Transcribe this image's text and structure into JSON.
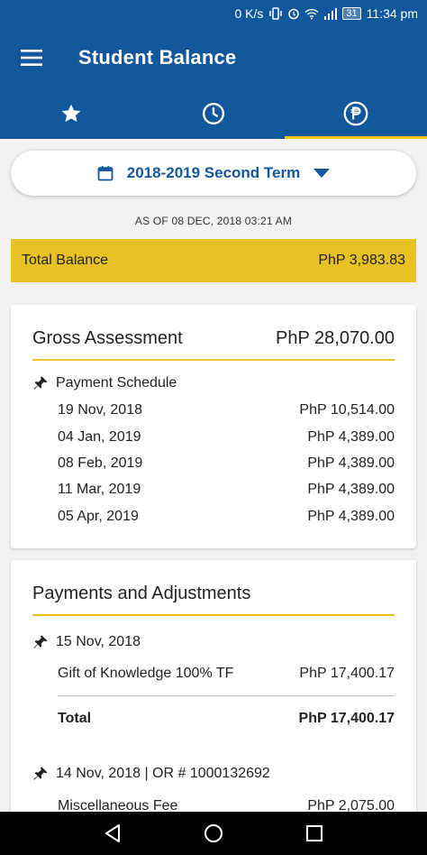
{
  "status_bar": {
    "net_speed": "0 K/s",
    "battery": "31",
    "time": "11:34 pm"
  },
  "app_bar": {
    "title": "Student Balance",
    "menu_icon": "hamburger-menu-icon"
  },
  "tabs": [
    {
      "icon": "star-icon",
      "active": false
    },
    {
      "icon": "clock-icon",
      "active": false
    },
    {
      "icon": "peso-icon",
      "active": true
    }
  ],
  "term_selector": {
    "label": "2018-2019 Second Term",
    "icon": "calendar-icon",
    "dropdown_icon": "dropdown-arrow-icon"
  },
  "as_of": "AS OF 08 DEC, 2018 03:21 AM",
  "total_balance": {
    "label": "Total Balance",
    "amount": "PhP 3,983.83"
  },
  "gross_assessment": {
    "title": "Gross Assessment",
    "amount": "PhP 28,070.00",
    "schedule_title": "Payment Schedule",
    "schedule": [
      {
        "date": "19 Nov, 2018",
        "amount": "PhP 10,514.00"
      },
      {
        "date": "04 Jan, 2019",
        "amount": "PhP 4,389.00"
      },
      {
        "date": "08 Feb, 2019",
        "amount": "PhP 4,389.00"
      },
      {
        "date": "11 Mar, 2019",
        "amount": "PhP 4,389.00"
      },
      {
        "date": "05 Apr, 2019",
        "amount": "PhP 4,389.00"
      }
    ]
  },
  "payments": {
    "title": "Payments and Adjustments",
    "groups": [
      {
        "header": "15 Nov, 2018",
        "items": [
          {
            "label": "Gift of Knowledge 100% TF",
            "amount": "PhP 17,400.17"
          }
        ],
        "total_label": "Total",
        "total_amount": "PhP 17,400.17"
      },
      {
        "header": "14 Nov, 2018 | OR # 1000132692",
        "items": [
          {
            "label": "Miscellaneous Fee",
            "amount": "PhP 2,075.00"
          }
        ]
      }
    ]
  },
  "colors": {
    "primary": "#12579b",
    "accent": "#e8c224"
  }
}
